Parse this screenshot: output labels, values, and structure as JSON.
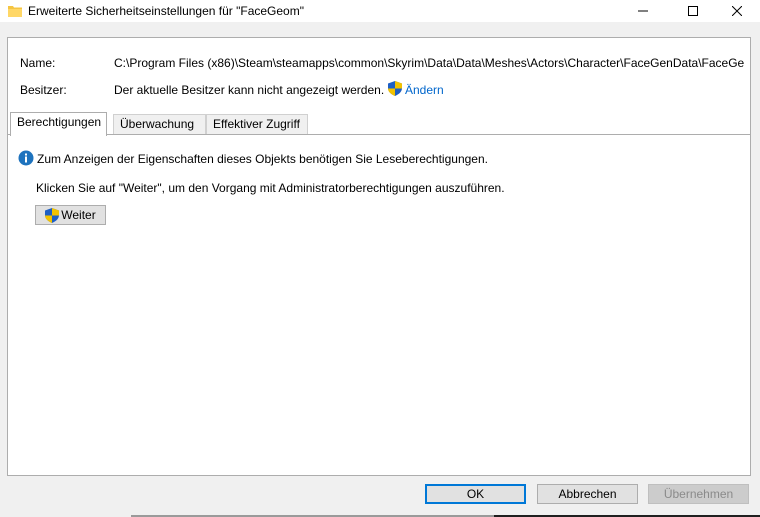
{
  "window": {
    "title": "Erweiterte Sicherheitseinstellungen für \"FaceGeom\"",
    "minimize": "—",
    "maximize": "☐",
    "close": "✕"
  },
  "details": {
    "name_label": "Name:",
    "name_value": "C:\\Program Files (x86)\\Steam\\steamapps\\common\\Skyrim\\Data\\Data\\Meshes\\Actors\\Character\\FaceGenData\\FaceGe",
    "owner_label": "Besitzer:",
    "owner_value": "Der aktuelle Besitzer kann nicht angezeigt werden.",
    "change_link": "Ändern"
  },
  "tabs": [
    {
      "label": "Berechtigungen",
      "active": true
    },
    {
      "label": "Überwachung",
      "active": false
    },
    {
      "label": "Effektiver Zugriff",
      "active": false
    }
  ],
  "content": {
    "info_text": "Zum Anzeigen der Eigenschaften dieses Objekts benötigen Sie Leseberechtigungen.",
    "hint_text": "Klicken Sie auf \"Weiter\", um den Vorgang mit Administratorberechtigungen auszuführen.",
    "continue_button": "Weiter"
  },
  "footer": {
    "ok": "OK",
    "cancel": "Abbrechen",
    "apply": "Übernehmen"
  },
  "colors": {
    "link": "#0066cc",
    "accent": "#0078d7",
    "info_icon": "#1e73be"
  },
  "icons": [
    "folder-icon",
    "shield-icon",
    "info-icon"
  ]
}
